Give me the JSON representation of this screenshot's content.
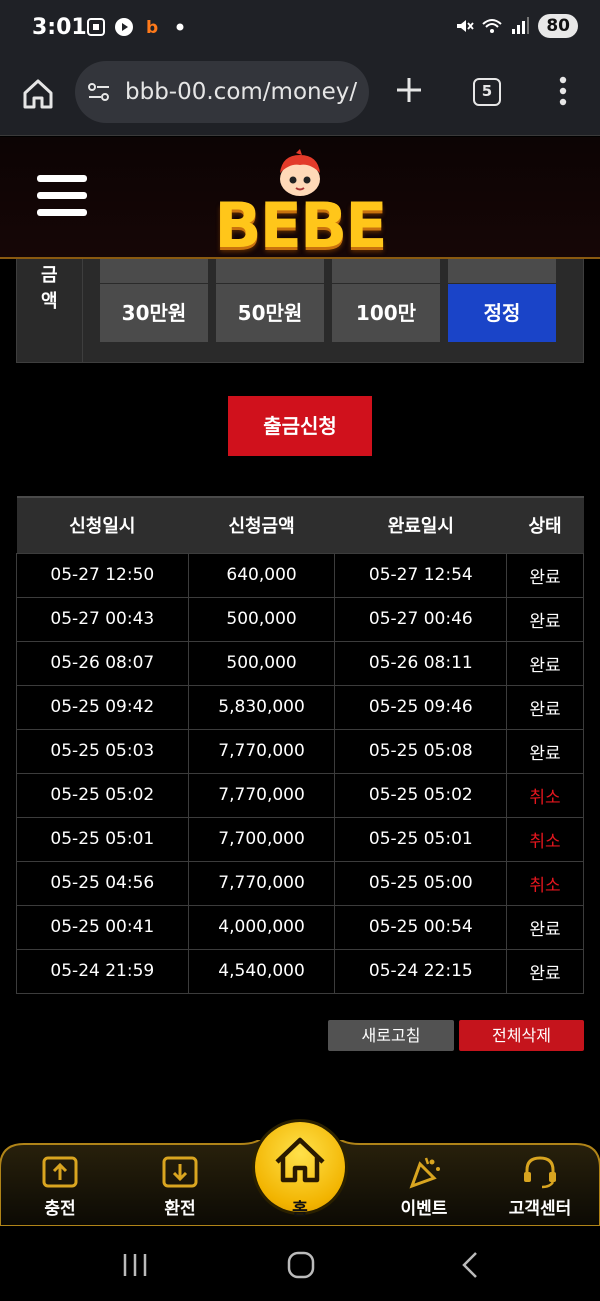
{
  "status_bar": {
    "time": "3:01",
    "battery": "80",
    "icons": [
      "screen-record-icon",
      "play-icon",
      "b-app-icon",
      "dot-icon",
      "mute-icon",
      "wifi-icon",
      "signal-icon"
    ]
  },
  "browser": {
    "url": "bbb-00.com/money/",
    "tab_count": "5"
  },
  "header": {
    "logo_text": "BEBE"
  },
  "amount_panel": {
    "label_chars": [
      "금",
      "액"
    ],
    "buttons": [
      "30만원",
      "50만원",
      "100만",
      "정정"
    ]
  },
  "withdraw_button": "출금신청",
  "history": {
    "headers": [
      "신청일시",
      "신청금액",
      "완료일시",
      "상태"
    ],
    "rows": [
      {
        "req": "05-27 12:50",
        "amount": "640,000",
        "done": "05-27 12:54",
        "status": "완료"
      },
      {
        "req": "05-27 00:43",
        "amount": "500,000",
        "done": "05-27 00:46",
        "status": "완료"
      },
      {
        "req": "05-26 08:07",
        "amount": "500,000",
        "done": "05-26 08:11",
        "status": "완료"
      },
      {
        "req": "05-25 09:42",
        "amount": "5,830,000",
        "done": "05-25 09:46",
        "status": "완료"
      },
      {
        "req": "05-25 05:03",
        "amount": "7,770,000",
        "done": "05-25 05:08",
        "status": "완료"
      },
      {
        "req": "05-25 05:02",
        "amount": "7,770,000",
        "done": "05-25 05:02",
        "status": "취소"
      },
      {
        "req": "05-25 05:01",
        "amount": "7,700,000",
        "done": "05-25 05:01",
        "status": "취소"
      },
      {
        "req": "05-25 04:56",
        "amount": "7,770,000",
        "done": "05-25 05:00",
        "status": "취소"
      },
      {
        "req": "05-25 00:41",
        "amount": "4,000,000",
        "done": "05-25 00:54",
        "status": "완료"
      },
      {
        "req": "05-24 21:59",
        "amount": "4,540,000",
        "done": "05-24 22:15",
        "status": "완료"
      }
    ]
  },
  "actions": {
    "refresh": "새로고침",
    "delete_all": "전체삭제"
  },
  "bottom_nav": {
    "deposit": "충전",
    "withdraw": "환전",
    "home": "홈",
    "event": "이벤트",
    "support": "고객센터"
  },
  "colors": {
    "accent_red": "#d0111c",
    "accent_blue": "#1a44c8",
    "gold": "#f2b400",
    "cancel_text": "#e3161e"
  }
}
